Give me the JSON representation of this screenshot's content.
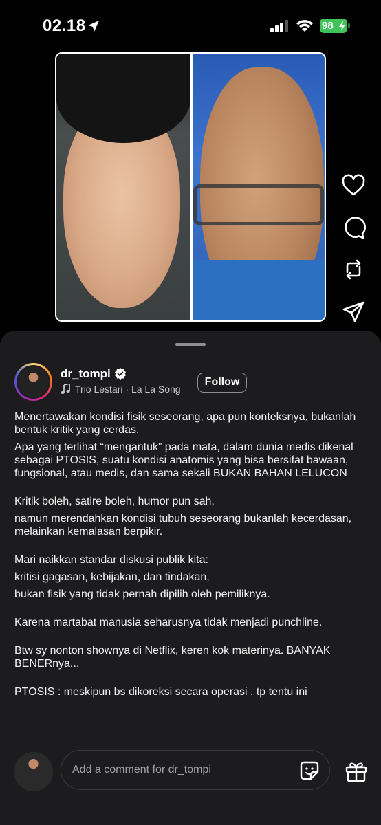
{
  "status": {
    "time": "02.18",
    "battery": "98"
  },
  "post": {
    "username": "dr_tompi",
    "song": "Trio Lestari · La La Song",
    "follow_label": "Follow",
    "caption": [
      "Menertawakan kondisi fisik seseorang, apa pun konteksnya, bukanlah bentuk kritik yang cerdas.",
      "Apa yang terlihat “mengantuk” pada mata, dalam dunia medis dikenal sebagai PTOSIS, suatu kondisi anatomis yang bisa bersifat bawaan, fungsional, atau medis, dan sama sekali BUKAN BAHAN LELUCON",
      "Kritik boleh, satire boleh, humor pun sah,",
      "namun merendahkan kondisi tubuh seseorang bukanlah kecerdasan, melainkan kemalasan berpikir.",
      "Mari naikkan standar diskusi publik kita:",
      "kritisi gagasan, kebijakan, dan tindakan,",
      "bukan fisik yang tidak pernah dipilih oleh pemiliknya.",
      "Karena martabat manusia seharusnya tidak menjadi punchline.",
      "Btw sy nonton shownya di Netflix, keren kok materinya. BANYAK BENERnya...",
      "PTOSIS : meskipun bs dikoreksi secara operasi , tp tentu ini"
    ]
  },
  "comment": {
    "placeholder": "Add a comment for dr_tompi"
  },
  "colors": {
    "battery": "#3fc45a",
    "sheet": "#1c1c1e"
  }
}
